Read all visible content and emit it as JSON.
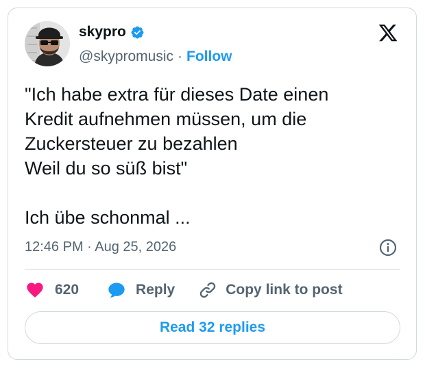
{
  "author": {
    "name": "skypro",
    "handle": "@skypromusic",
    "separator": "·",
    "follow_label": "Follow",
    "verified": true
  },
  "tweet": {
    "text": "\"Ich habe extra für dieses Date einen\nKredit aufnehmen müssen, um die\nZuckersteuer zu bezahlen\nWeil du so süß bist\"\n\nIch übe schonmal ...",
    "timestamp": "12:46 PM · Aug 25, 2026"
  },
  "actions": {
    "like_count": "620",
    "reply_label": "Reply",
    "copy_link_label": "Copy link to post"
  },
  "read_replies_label": "Read 32 replies",
  "icons": {
    "logo": "x-logo-icon",
    "verified": "verified-badge-icon",
    "info": "info-icon",
    "like": "heart-icon",
    "reply": "speech-bubble-icon",
    "copy": "link-icon"
  },
  "colors": {
    "accent": "#1d9bf0",
    "like": "#f91880",
    "text": "#0f1419",
    "secondary": "#536471",
    "border": "#cfd9de"
  }
}
